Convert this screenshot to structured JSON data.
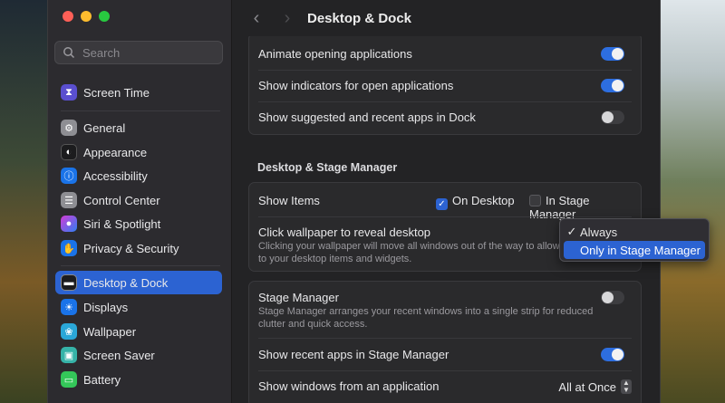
{
  "sidebar": {
    "search_placeholder": "Search",
    "items": [
      {
        "label": "Screen Time",
        "icon": "hourglass-icon",
        "color": "#5a4fcf"
      },
      {
        "label": "General",
        "icon": "gear-icon",
        "color": "#8e8e93"
      },
      {
        "label": "Appearance",
        "icon": "appearance-icon",
        "color": "#1c1c1e"
      },
      {
        "label": "Accessibility",
        "icon": "accessibility-icon",
        "color": "#1a73e8"
      },
      {
        "label": "Control Center",
        "icon": "control-center-icon",
        "color": "#8e8e93"
      },
      {
        "label": "Siri & Spotlight",
        "icon": "siri-icon",
        "color": "#6b3fd1"
      },
      {
        "label": "Privacy & Security",
        "icon": "hand-icon",
        "color": "#1a73e8"
      },
      {
        "label": "Desktop & Dock",
        "icon": "dock-icon",
        "color": "#1c1c1e"
      },
      {
        "label": "Displays",
        "icon": "sun-icon",
        "color": "#1a73e8"
      },
      {
        "label": "Wallpaper",
        "icon": "wallpaper-icon",
        "color": "#2aa7d8"
      },
      {
        "label": "Screen Saver",
        "icon": "screen-saver-icon",
        "color": "#36b3a8"
      },
      {
        "label": "Battery",
        "icon": "battery-icon",
        "color": "#34c759"
      }
    ]
  },
  "header": {
    "title": "Desktop & Dock"
  },
  "dock_section": {
    "animate_opening": {
      "label": "Animate opening applications",
      "on": true
    },
    "show_indicators": {
      "label": "Show indicators for open applications",
      "on": true
    },
    "show_suggested": {
      "label": "Show suggested and recent apps in Dock",
      "on": false
    }
  },
  "stage_section": {
    "title": "Desktop & Stage Manager",
    "show_items": {
      "label": "Show Items",
      "on_desktop": {
        "label": "On Desktop",
        "checked": true
      },
      "in_stage_manager": {
        "label": "In Stage Manager",
        "checked": false
      }
    },
    "click_wallpaper": {
      "label": "Click wallpaper to reveal desktop",
      "description": "Clicking your wallpaper will move all windows out of the way to allow access to your desktop items and widgets.",
      "menu": {
        "options": [
          "Always",
          "Only in Stage Manager"
        ],
        "checked": "Always",
        "highlighted": "Only in Stage Manager"
      }
    },
    "stage_manager": {
      "label": "Stage Manager",
      "description": "Stage Manager arranges your recent windows into a single strip for reduced clutter and quick access.",
      "on": false
    },
    "show_recent_apps": {
      "label": "Show recent apps in Stage Manager",
      "on": true
    },
    "show_windows": {
      "label": "Show windows from an application",
      "value": "All at Once"
    }
  },
  "colors": {
    "accent": "#2c63d2",
    "toggle_on": "#2d6ee0"
  }
}
